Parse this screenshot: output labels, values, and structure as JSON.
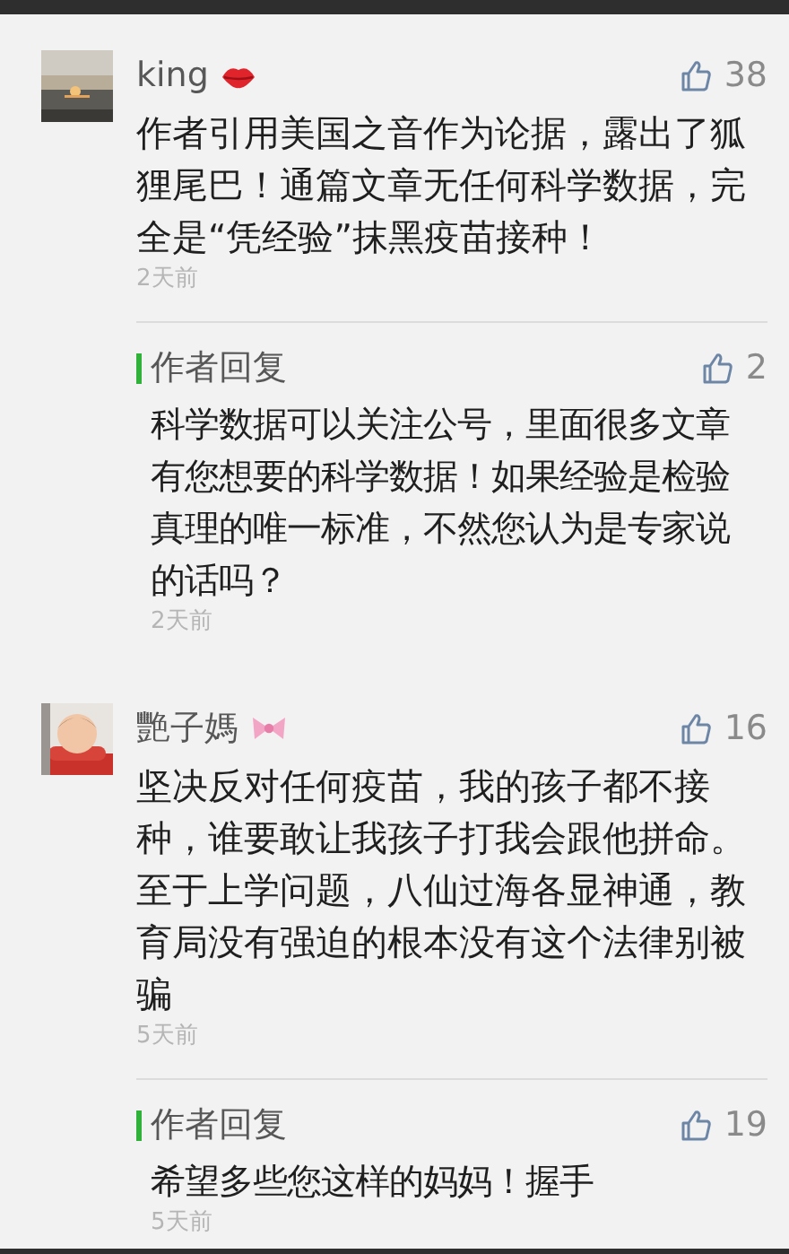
{
  "comments": [
    {
      "name": "king",
      "likes": "38",
      "text": "作者引用美国之音作为论据，露出了狐狸尾巴！通篇文章无任何科学数据，完全是“凭经验”抹黑疫苗接种！",
      "time": "2天前",
      "reply": {
        "label": "作者回复",
        "likes": "2",
        "text": "科学数据可以关注公号，里面很多文章有您想要的科学数据！如果经验是检验真理的唯一标准，不然您认为是专家说的话吗？",
        "time": "2天前"
      }
    },
    {
      "name": "艷子媽",
      "likes": "16",
      "text": "坚决反对任何疫苗，我的孩子都不接种，谁要敢让我孩子打我会跟他拼命。至于上学问题，八仙过海各显神通，教育局没有强迫的根本没有这个法律别被骗",
      "time": "5天前",
      "reply": {
        "label": "作者回复",
        "likes": "19",
        "text": "希望多些您这样的妈妈！握手",
        "time": "5天前"
      }
    }
  ]
}
